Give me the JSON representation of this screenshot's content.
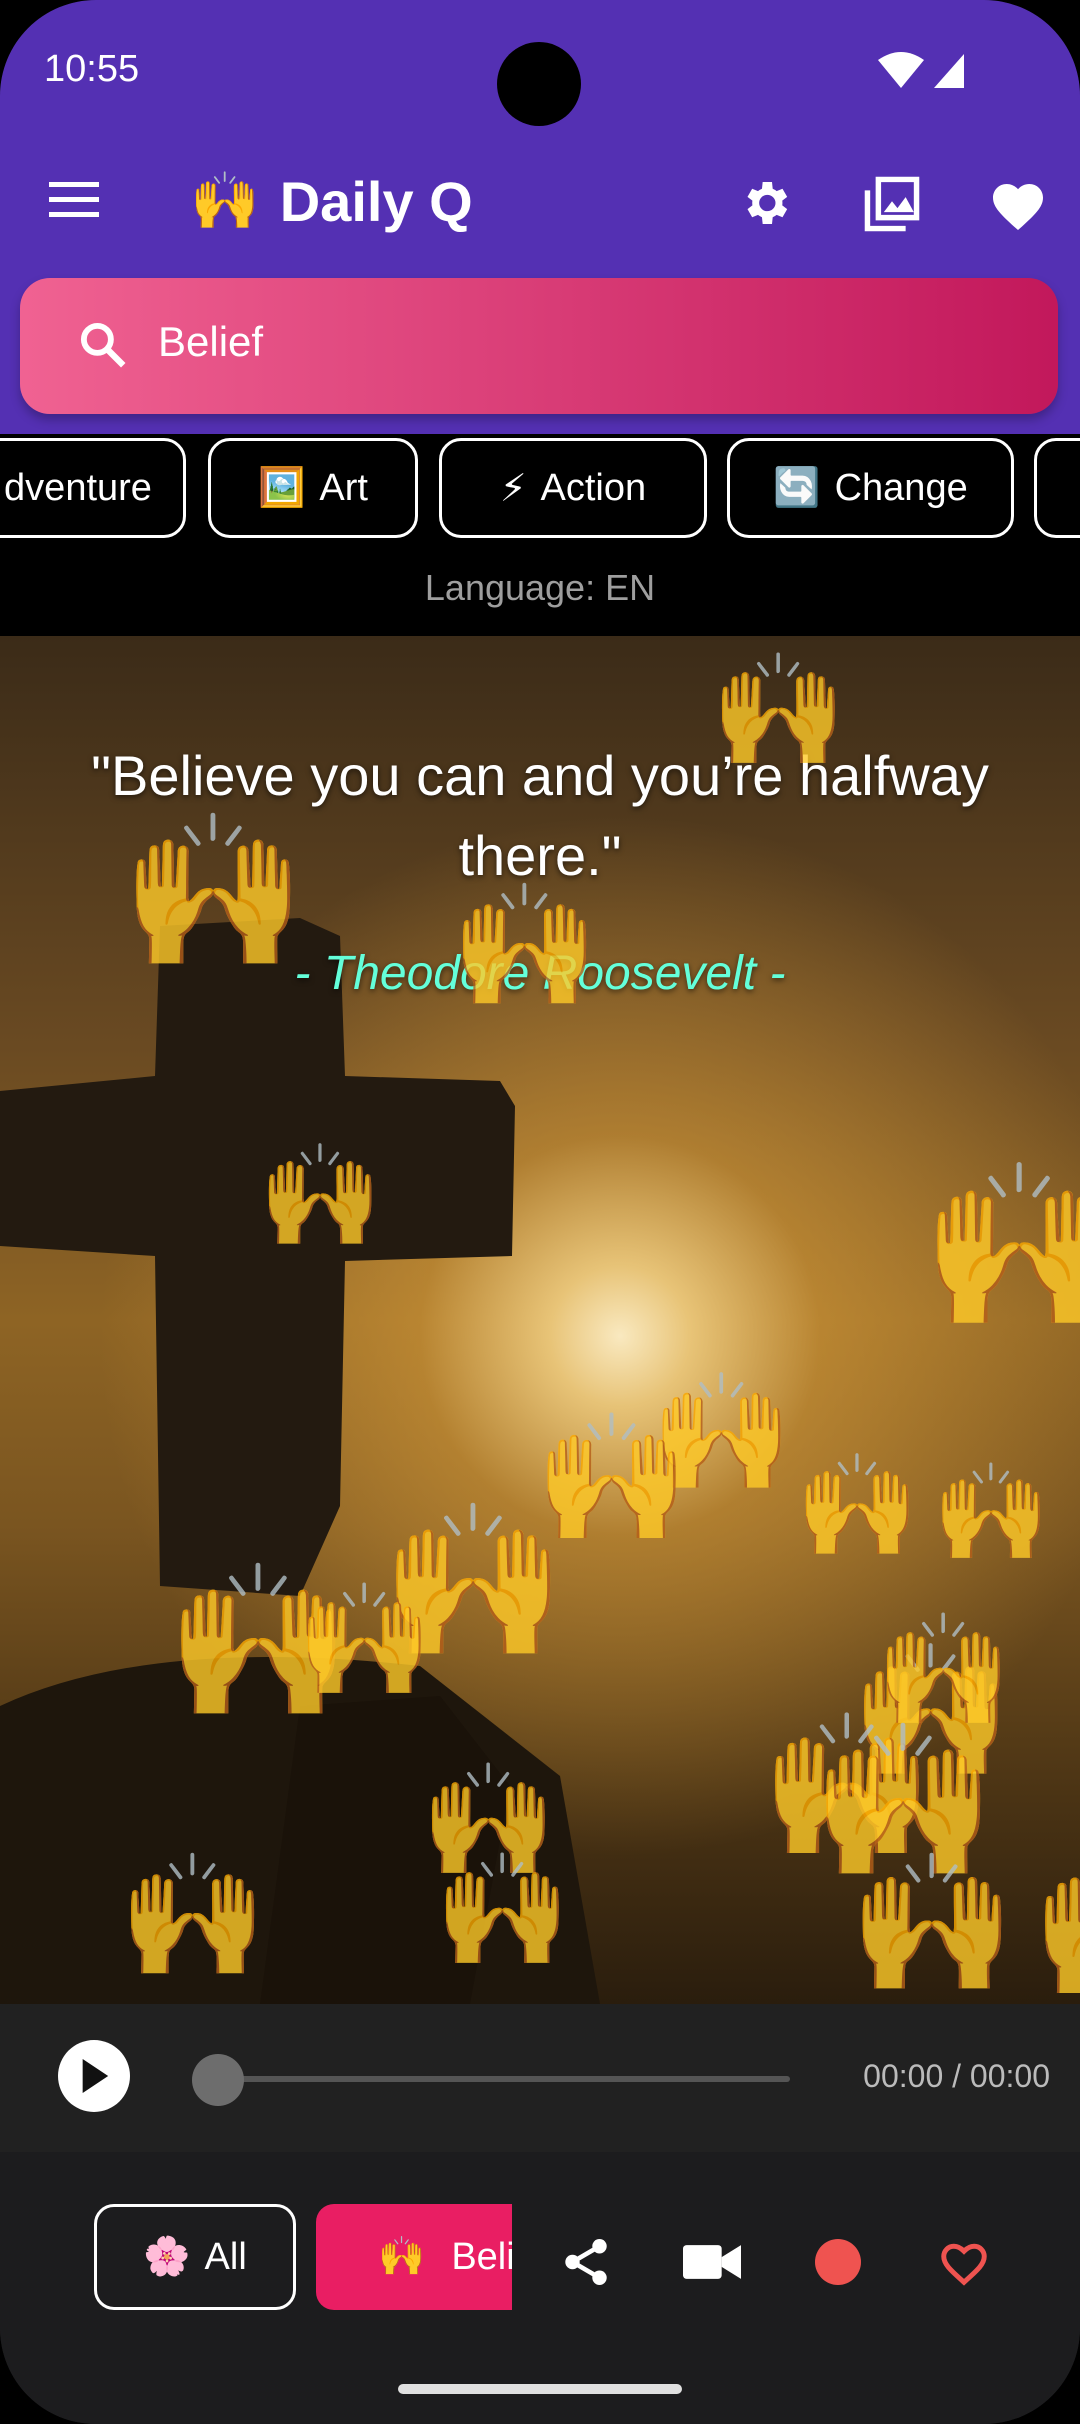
{
  "status": {
    "time": "10:55"
  },
  "app": {
    "title": "Daily Q",
    "title_emoji": "🙌"
  },
  "search": {
    "value": "Belief"
  },
  "categories": [
    {
      "label": "dventure",
      "emoji": ""
    },
    {
      "label": "Art",
      "emoji": "🖼️"
    },
    {
      "label": "Action",
      "emoji": "⚡"
    },
    {
      "label": "Change",
      "emoji": "🔄"
    }
  ],
  "language_label": "Language: EN",
  "quote": {
    "text": "\"Believe you can and you’re halfway there.\"",
    "author": "- Theodore Roosevelt -"
  },
  "player": {
    "time": "00:00 / 00:00",
    "progress": 0
  },
  "bottom": {
    "all_label": "All",
    "all_emoji": "🌸",
    "selected_label": "Belief",
    "selected_emoji": "🙌"
  },
  "colors": {
    "appbar": "#5430b3",
    "search_start": "#f06292",
    "search_end": "#c2185b",
    "author": "#64ffda",
    "selected_chip": "#e91e63",
    "record": "#ef5350"
  }
}
